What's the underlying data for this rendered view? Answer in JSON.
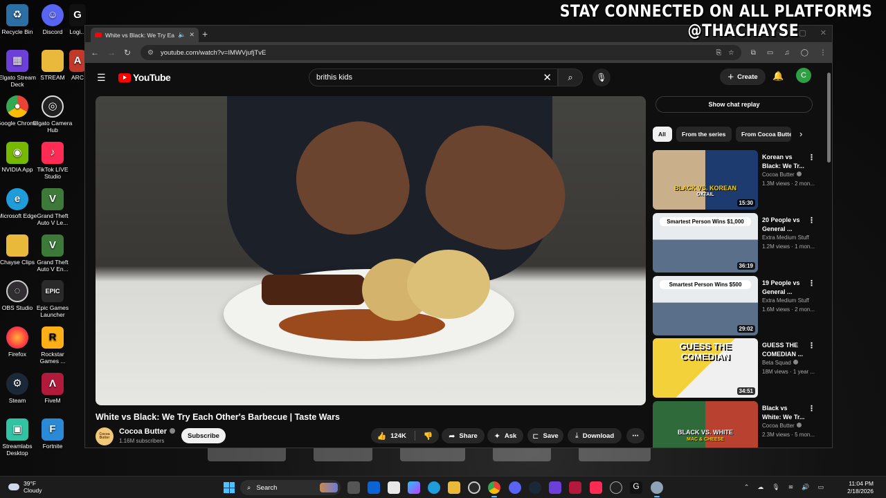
{
  "overlay": {
    "line1": "STAY CONNECTED ON ALL PLATFORMS",
    "line2": "@THACHAYSE"
  },
  "desktop_icons": [
    {
      "label": "Recycle Bin",
      "icon": "recycle-bin-icon",
      "color": "#2d6ea3"
    },
    {
      "label": "Discord",
      "icon": "discord-icon",
      "color": "#5865f2"
    },
    {
      "label": "Logi...",
      "icon": "logitech-g-icon",
      "color": "#111111"
    },
    {
      "label": "Elgato Stream Deck",
      "icon": "stream-deck-icon",
      "color": "#6b3fd8"
    },
    {
      "label": "STREAM",
      "icon": "folder-icon",
      "color": "#e8b93a"
    },
    {
      "label": "ARC",
      "icon": "arc-icon",
      "color": "#c0392b"
    },
    {
      "label": "Google Chrome",
      "icon": "chrome-icon",
      "color": "#34a853"
    },
    {
      "label": "Elgato Camera Hub",
      "icon": "camera-hub-icon",
      "color": "#222222"
    },
    {
      "label": "NVIDIA App",
      "icon": "nvidia-icon",
      "color": "#76b900"
    },
    {
      "label": "TikTok LIVE Studio",
      "icon": "tiktok-icon",
      "color": "#fe2c55"
    },
    {
      "label": "Microsoft Edge",
      "icon": "edge-icon",
      "color": "#1f9cda"
    },
    {
      "label": "Grand Theft Auto V Le...",
      "icon": "gta-icon",
      "color": "#3d7a3a"
    },
    {
      "label": "Chayse Clips",
      "icon": "folder-icon",
      "color": "#e8b93a"
    },
    {
      "label": "Grand Theft Auto V En...",
      "icon": "gta-icon",
      "color": "#3d7a3a"
    },
    {
      "label": "OBS Studio",
      "icon": "obs-icon",
      "color": "#302e31"
    },
    {
      "label": "Epic Games Launcher",
      "icon": "epic-games-icon",
      "color": "#2a2a2a"
    },
    {
      "label": "Firefox",
      "icon": "firefox-icon",
      "color": "#ff7139"
    },
    {
      "label": "Rockstar Games ...",
      "icon": "rockstar-icon",
      "color": "#fcaf17"
    },
    {
      "label": "Steam",
      "icon": "steam-icon",
      "color": "#1b2838"
    },
    {
      "label": "FiveM",
      "icon": "fivem-icon",
      "color": "#b21a3c"
    },
    {
      "label": "Streamlabs Desktop",
      "icon": "streamlabs-icon",
      "color": "#31c3a2"
    },
    {
      "label": "Fortnite",
      "icon": "fortnite-icon",
      "color": "#2a8ad6"
    }
  ],
  "browser": {
    "tab_title": "White vs Black: We Try Each",
    "url": "youtube.com/watch?v=IMWVjufjTvE"
  },
  "youtube": {
    "logo_text": "YouTube",
    "search_query": "brithis kids",
    "create_label": "Create",
    "avatar_letter": "C",
    "video": {
      "title": "White vs Black: We Try Each Other's Barbecue | Taste Wars",
      "channel": "Cocoa Butter",
      "channel_avatar_text": "Cocoa Butter",
      "subscribers": "1.16M subscribers",
      "subscribe_label": "Subscribe",
      "likes": "124K",
      "share_label": "Share",
      "ask_label": "Ask",
      "save_label": "Save",
      "download_label": "Download"
    },
    "chat_replay_label": "Show chat replay",
    "chips": [
      "All",
      "From the series",
      "From Cocoa Butter"
    ],
    "recommendations": [
      {
        "title": "Korean vs Black: We Tr...",
        "channel": "Cocoa Butter",
        "verified": true,
        "views": "1.3M views · 2 mon...",
        "duration": "15:30",
        "thumb_text": "BLACK VS. KOREAN",
        "thumb_sub": "OXTAIL"
      },
      {
        "title": "20 People vs General ...",
        "channel": "Extra Medium Stuff",
        "verified": false,
        "views": "1.2M views · 1 mon...",
        "duration": "36:19",
        "thumb_text": "Smartest Person Wins $1,000",
        "thumb_sub": ""
      },
      {
        "title": "19 People vs General ...",
        "channel": "Extra Medium Stuff",
        "verified": false,
        "views": "1.6M views · 2 mon...",
        "duration": "29:02",
        "thumb_text": "Smartest Person Wins $500",
        "thumb_sub": ""
      },
      {
        "title": "GUESS THE COMEDIAN ...",
        "channel": "Beta Squad",
        "verified": true,
        "views": "18M views · 1 year ...",
        "duration": "34:51",
        "thumb_text": "GUESS THE COMEDIAN",
        "thumb_sub": ""
      },
      {
        "title": "Black vs White: We Tr...",
        "channel": "Cocoa Butter",
        "verified": true,
        "views": "2.3M views · 5 mon...",
        "duration": "",
        "thumb_text": "BLACK VS. WHITE",
        "thumb_sub": "MAC & CHEESE"
      }
    ]
  },
  "taskbar": {
    "temperature": "39°F",
    "condition": "Cloudy",
    "search_label": "Search",
    "time": "11:04 PM",
    "date": "2/18/2026"
  },
  "colors": {
    "youtube_red": "#ff0000",
    "accent_blue": "#4cc2ff",
    "page_bg": "#0f0f0f"
  }
}
